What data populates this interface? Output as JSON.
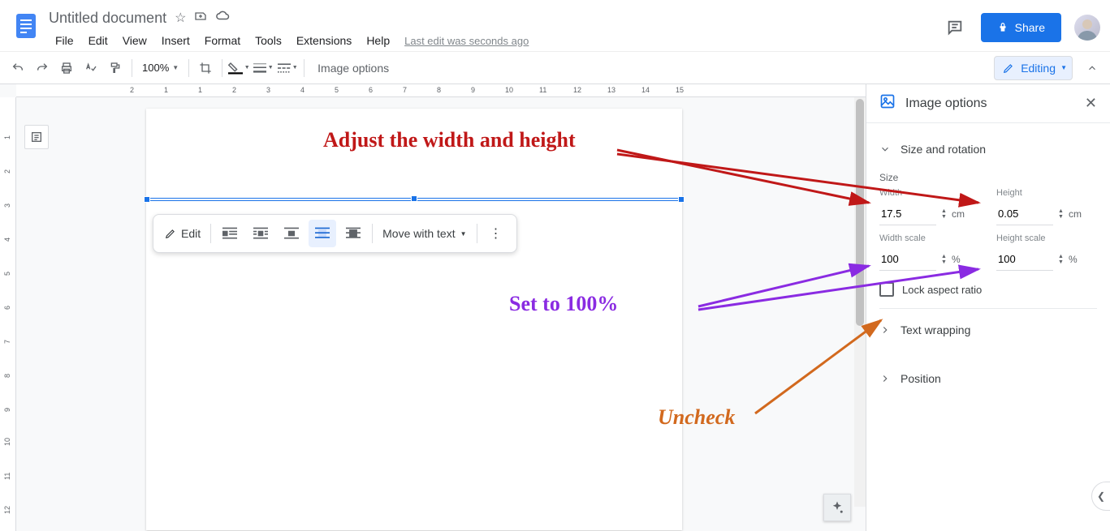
{
  "doc": {
    "title": "Untitled document",
    "last_edit": "Last edit was seconds ago"
  },
  "menus": [
    "File",
    "Edit",
    "View",
    "Insert",
    "Format",
    "Tools",
    "Extensions",
    "Help"
  ],
  "share": "Share",
  "toolbar": {
    "zoom": "100%",
    "image_options": "Image options",
    "editing": "Editing"
  },
  "float": {
    "edit": "Edit",
    "move": "Move with text"
  },
  "panel": {
    "title": "Image options",
    "section_size": "Size and rotation",
    "size_label": "Size",
    "width_label": "Width",
    "height_label": "Height",
    "width_val": "17.5",
    "height_val": "0.05",
    "unit": "cm",
    "wscale_label": "Width scale",
    "hscale_label": "Height scale",
    "wscale_val": "100",
    "hscale_val": "100",
    "pct": "%",
    "lock": "Lock aspect ratio",
    "text_wrapping": "Text wrapping",
    "position": "Position"
  },
  "annotations": {
    "adjust": "Adjust the width and height",
    "set100": "Set to 100%",
    "uncheck": "Uncheck"
  },
  "ruler_numbers": [
    "2",
    "1",
    "1",
    "2",
    "3",
    "4",
    "5",
    "6",
    "7",
    "8",
    "9",
    "10",
    "11",
    "12",
    "13",
    "14",
    "15"
  ]
}
